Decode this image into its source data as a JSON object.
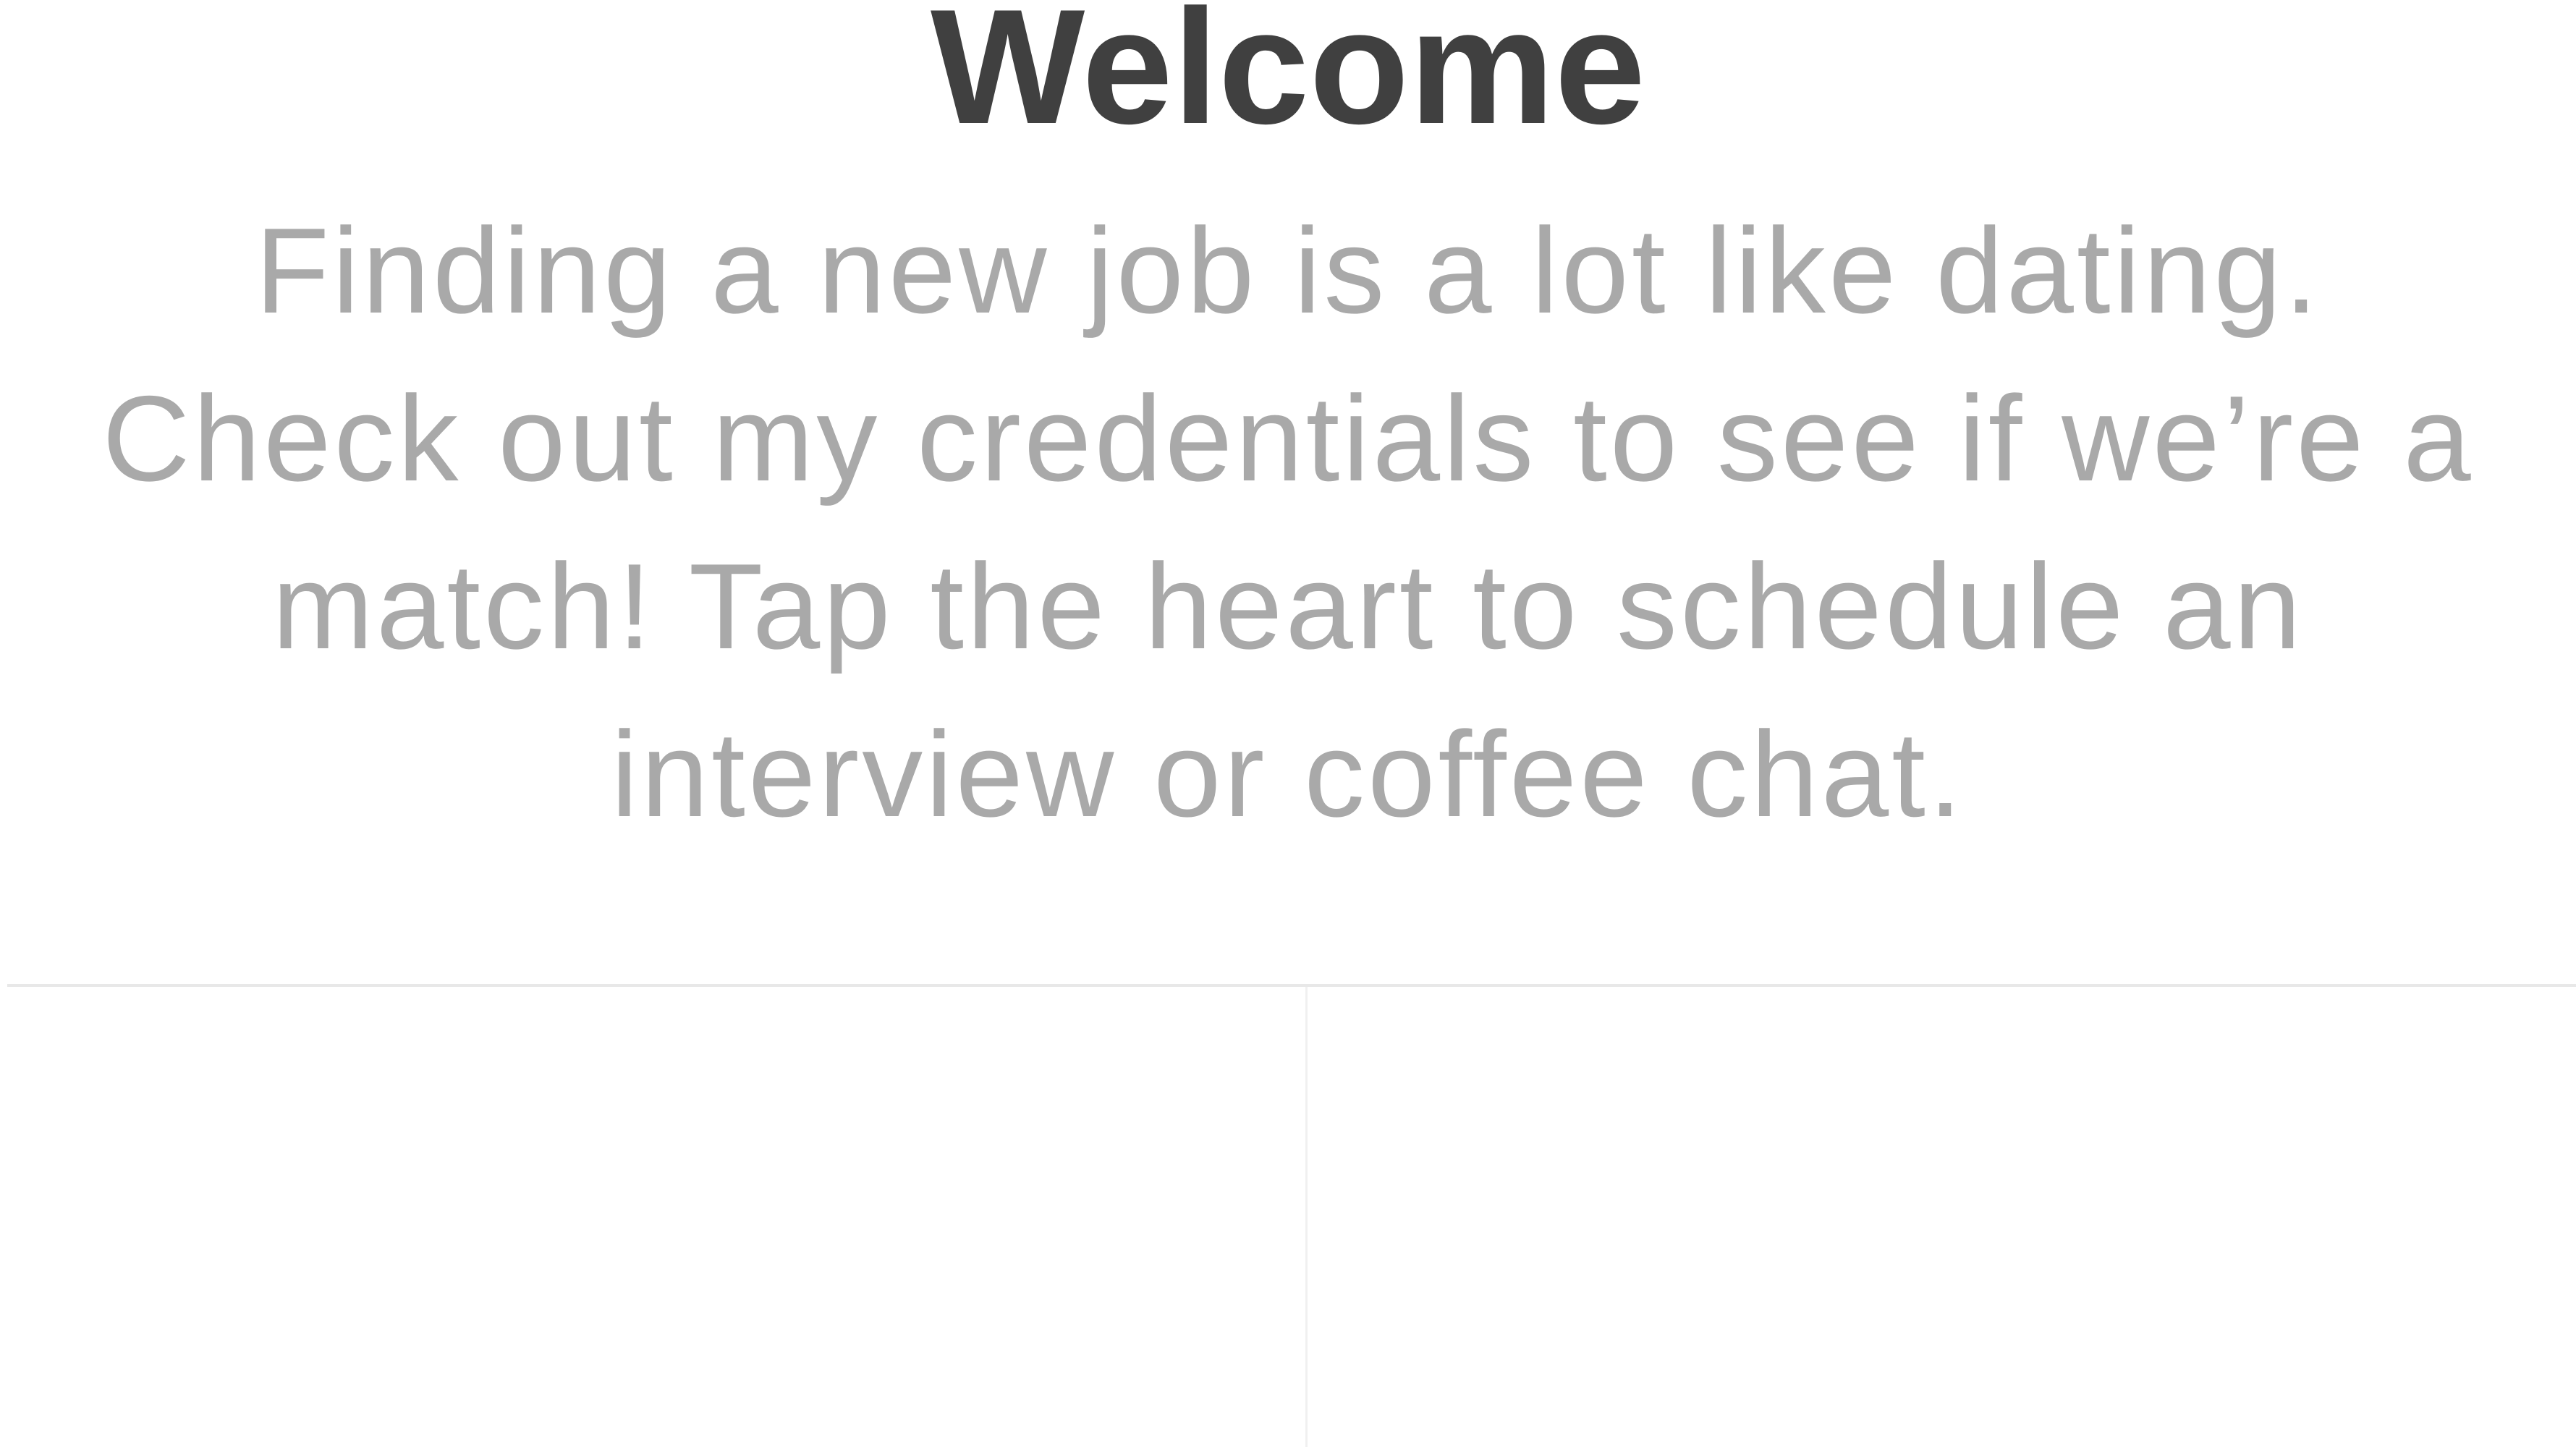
{
  "header": {
    "title": "Welcome",
    "intro_lines": [
      "Finding a new job is a lot like dating.",
      "Check out my credentials to see if we’re a",
      "match! Tap the heart to schedule an",
      "interview or coffee chat."
    ]
  },
  "colors": {
    "title": "#404040",
    "intro": "#a9a9a9",
    "divider": "#e8e8e8",
    "background": "#ffffff"
  }
}
